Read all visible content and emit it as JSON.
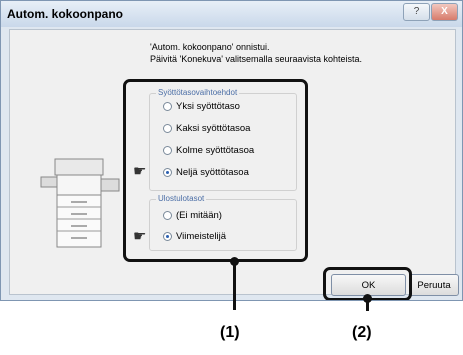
{
  "dialog": {
    "title": "Autom. kokoonpano",
    "help_label": "?",
    "close_label": "X",
    "message_line1": "'Autom. kokoonpano' onnistui.",
    "message_line2": "Päivitä 'Konekuva' valitsemalla seuraavista kohteista."
  },
  "input_tray_options": {
    "title": "Syöttötasovaihtoehdot",
    "options": [
      {
        "label": "Yksi syöttötaso",
        "selected": false
      },
      {
        "label": "Kaksi syöttötasoa",
        "selected": false
      },
      {
        "label": "Kolme syöttötasoa",
        "selected": false
      },
      {
        "label": "Neljä syöttötasoa",
        "selected": true
      }
    ]
  },
  "output_trays": {
    "title": "Ulostulotasot",
    "options": [
      {
        "label": "(Ei mitään)",
        "selected": false
      },
      {
        "label": "Viimeistelijä",
        "selected": true
      }
    ]
  },
  "buttons": {
    "ok": "OK",
    "cancel": "Peruuta"
  },
  "annotations": {
    "callout1": "(1)",
    "callout2": "(2)"
  }
}
